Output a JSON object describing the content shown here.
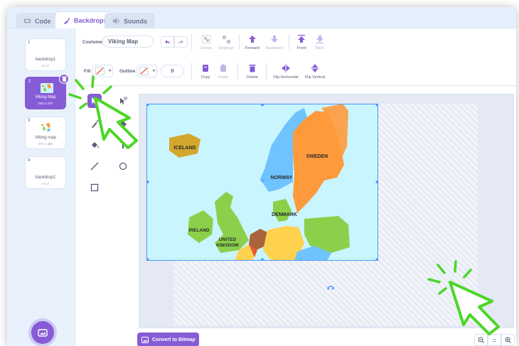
{
  "tabs": [
    {
      "label": "Code",
      "icon": "code-icon"
    },
    {
      "label": "Backdrops",
      "icon": "paintbrush-icon"
    },
    {
      "label": "Sounds",
      "icon": "speaker-icon"
    }
  ],
  "backdrops": [
    {
      "num": "1",
      "name": "backdrop1",
      "size": "2 x 2"
    },
    {
      "num": "2",
      "name": "Viking Map",
      "size": "553 x 378",
      "selected": true
    },
    {
      "num": "3",
      "name": "Viking map",
      "size": "477 x 360"
    },
    {
      "num": "4",
      "name": "backdrop2",
      "size": "2 x 2"
    }
  ],
  "editor": {
    "costume_label": "Costume",
    "costume_name": "Viking Map",
    "fill_label": "Fill",
    "outline_label": "Outline",
    "outline_width": "0",
    "tools": {
      "group": "Group",
      "ungroup": "Ungroup",
      "forward": "Forward",
      "backward": "Backward",
      "front": "Front",
      "back": "Back",
      "copy": "Copy",
      "paste": "Paste",
      "delete": "Delete",
      "flip_h": "Flip Horizontal",
      "flip_v": "Flip Vertical"
    },
    "convert_label": "Convert to Bitmap",
    "zoom": {
      "out": "-",
      "reset": "=",
      "in": "+"
    }
  },
  "map_labels": {
    "iceland": "ICELAND",
    "sweden": "SWEDEN",
    "norway": "NORWAY",
    "denmark": "DENMARK",
    "ireland": "IRELAND",
    "uk_line1": "UNITED",
    "uk_line2": "KINGDOM"
  },
  "colors": {
    "accent": "#855cd6",
    "selection": "#4c97ff",
    "sea": "#c9f5ff",
    "callout": "#4cd627"
  }
}
